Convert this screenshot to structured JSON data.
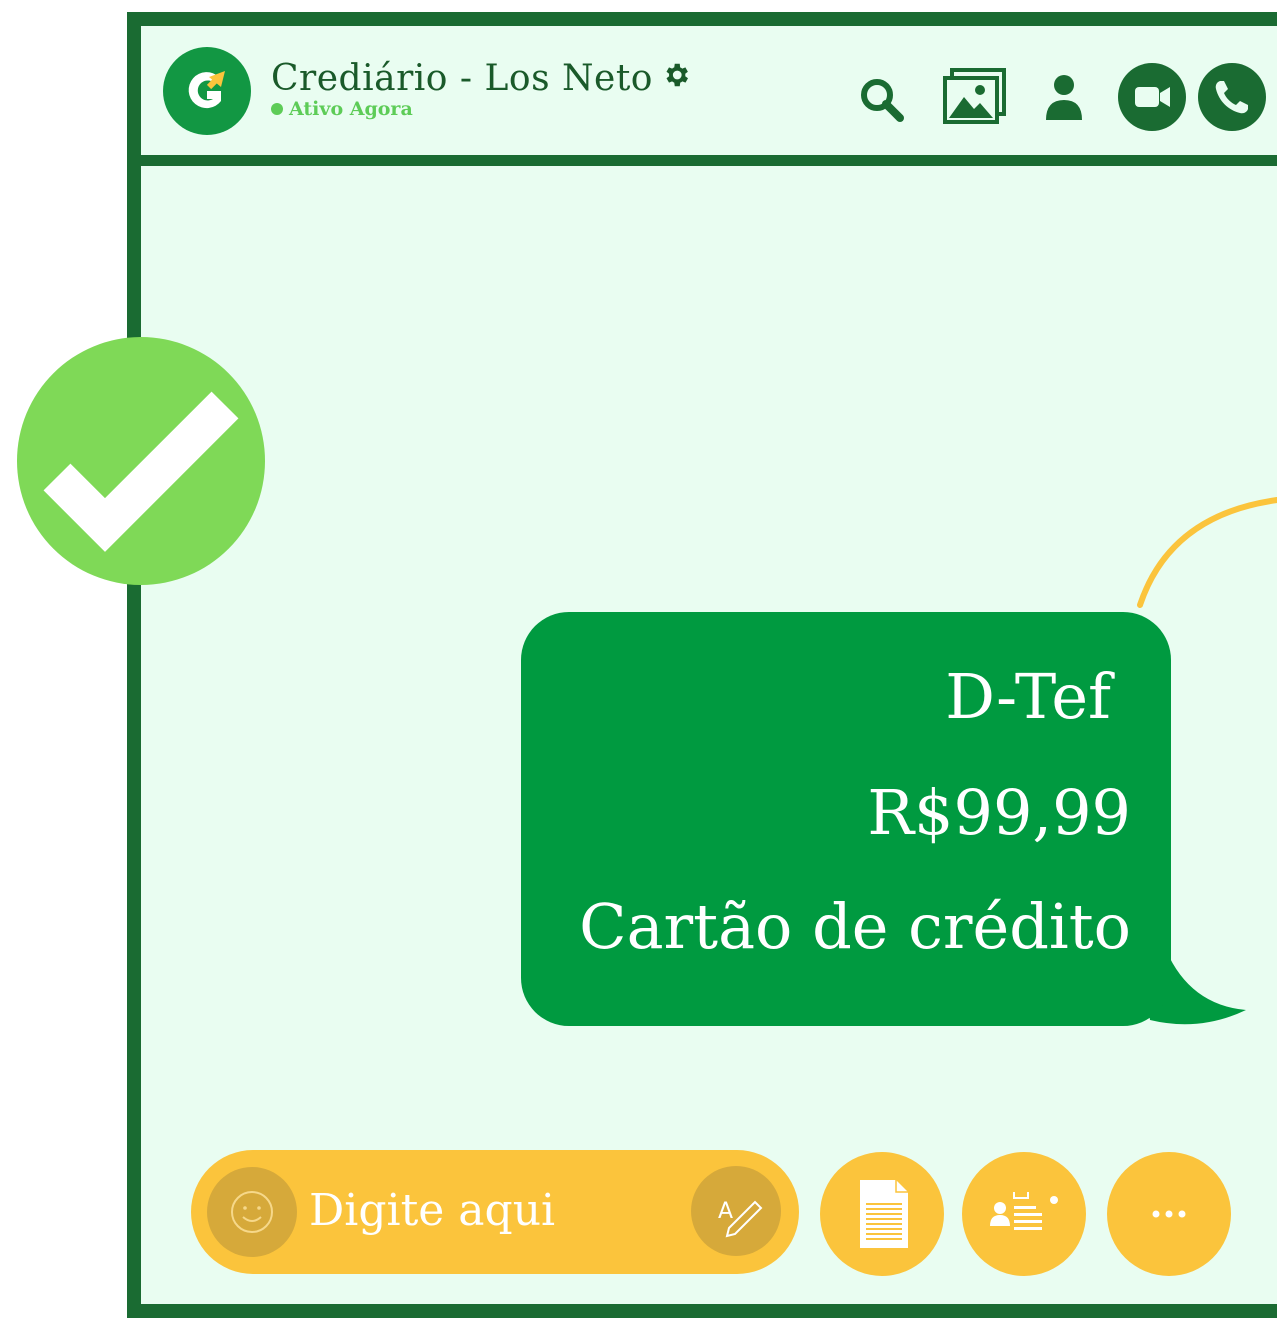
{
  "header": {
    "title": "Crediário - Los Neto",
    "status": "Ativo Agora"
  },
  "icons": {
    "logo": "app-logo",
    "settings": "gear-icon",
    "search": "search-icon",
    "gallery": "gallery-icon",
    "contact": "user-icon",
    "video": "video-call-icon",
    "call": "phone-icon",
    "badge": "check-icon"
  },
  "message": {
    "lines": [
      "D-Tef",
      "R$99,99",
      "Cartão de crédito"
    ]
  },
  "composer": {
    "placeholder": "Digite aqui",
    "more_label": "···"
  },
  "colors": {
    "frame": "#1a6b32",
    "background": "#e9fdf1",
    "bubble": "#009a40",
    "accent": "#fbc43c",
    "check": "#7fd957"
  }
}
